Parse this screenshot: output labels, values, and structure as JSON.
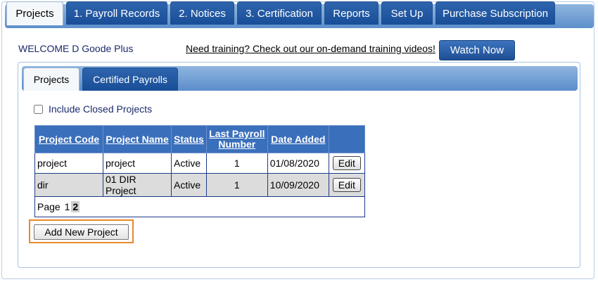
{
  "top_tabs": [
    {
      "label": "Projects",
      "active": true
    },
    {
      "label": "1. Payroll Records",
      "active": false
    },
    {
      "label": "2. Notices",
      "active": false
    },
    {
      "label": "3. Certification",
      "active": false
    },
    {
      "label": "Reports",
      "active": false
    },
    {
      "label": "Set Up",
      "active": false
    },
    {
      "label": "Purchase Subscription",
      "active": false
    }
  ],
  "welcome_text": "WELCOME D Goode Plus",
  "training_link": "Need training? Check out our on-demand training videos!",
  "watch_now_label": "Watch Now",
  "inner_tabs": [
    {
      "label": "Projects",
      "active": true
    },
    {
      "label": "Certified Payrolls",
      "active": false
    }
  ],
  "include_closed_label": "Include Closed Projects",
  "include_closed_checked": false,
  "table": {
    "headers": {
      "code": "Project Code",
      "name": "Project Name",
      "status": "Status",
      "last_payroll_1": "Last Payroll",
      "last_payroll_2": "Number",
      "date_added": "Date Added"
    },
    "rows": [
      {
        "code": "project",
        "name": "project",
        "status": "Active",
        "last_payroll": "1",
        "date_added": "01/08/2020",
        "edit": "Edit"
      },
      {
        "code": "dir",
        "name": "01 DIR Project",
        "status": "Active",
        "last_payroll": "1",
        "date_added": "10/09/2020",
        "edit": "Edit"
      }
    ],
    "pager": {
      "label": "Page",
      "pages": [
        "1",
        "2"
      ],
      "current": "2"
    }
  },
  "add_new_label": "Add New Project",
  "colors": {
    "accent_orange": "#e8892b",
    "tab_blue": "#184d97",
    "header_blue": "#3a6fbc"
  }
}
